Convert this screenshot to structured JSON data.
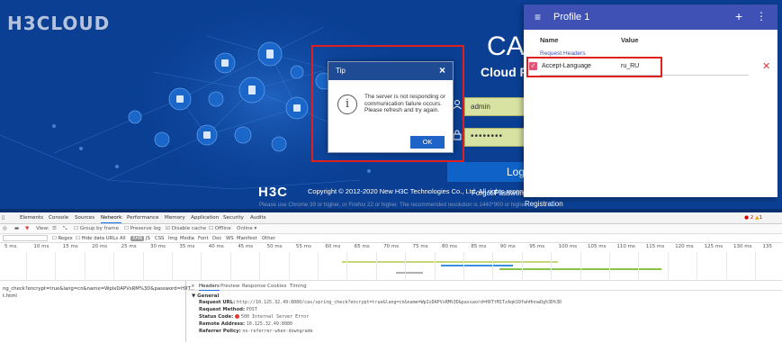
{
  "brand": {
    "logo": "H3CLOUD",
    "ca_mark": "CA",
    "product_title": "Cloud P"
  },
  "login": {
    "username_value": "admin",
    "password_value": "••••••••",
    "login_button": "Log",
    "forgot_password": "Forgot Password",
    "h3c_mark": "H3C",
    "copyright": "Copyright © 2012-2020 New H3C Technologies Co., Ltd. All rights reserved.",
    "browser_hint": "Please use Chrome 39 or higher, or Firefox 22 or higher. The recommended resolution is 1440*900 or higher.",
    "registration": "Registration"
  },
  "tip_dialog": {
    "title": "Tip",
    "close_glyph": "×",
    "info_glyph": "i",
    "message": "The server is not responding or communication failure occurs. Please refresh and try again.",
    "ok_label": "OK"
  },
  "profile_panel": {
    "menu_glyph": "≡",
    "title": "Profile 1",
    "add_glyph": "+",
    "more_glyph": "⋮",
    "col_name": "Name",
    "col_value": "Value",
    "section": "Request Headers",
    "check_glyph": "✓",
    "header_name": "Accept-Language",
    "header_value": "ru_RU",
    "delete_glyph": "✕",
    "accent_color": "#3f51b5"
  },
  "devtools": {
    "tabs": [
      "Elements",
      "Console",
      "Sources",
      "Network",
      "Performance",
      "Memory",
      "Application",
      "Security",
      "Audits"
    ],
    "active_tab": "Network",
    "errors": "2",
    "warnings": "1",
    "toolbar": {
      "view": "View:",
      "group_by_frame": "Group by frame",
      "preserve_log": "Preserve log",
      "disable_cache": "Disable cache",
      "offline": "Offline",
      "online": "Online"
    },
    "filter": {
      "regex": "Regex",
      "hide_data_urls": "Hide data URLs",
      "types": [
        "All",
        "XHR",
        "JS",
        "CSS",
        "Img",
        "Media",
        "Font",
        "Doc",
        "WS",
        "Manifest",
        "Other"
      ],
      "selected_type": "XHR"
    },
    "ticks": [
      "5 ms",
      "10 ms",
      "15 ms",
      "20 ms",
      "25 ms",
      "30 ms",
      "35 ms",
      "40 ms",
      "45 ms",
      "50 ms",
      "55 ms",
      "60 ms",
      "65 ms",
      "70 ms",
      "75 ms",
      "80 ms",
      "85 ms",
      "90 ms",
      "95 ms",
      "100 ms",
      "105 ms",
      "110 ms",
      "115 ms",
      "120 ms",
      "125 ms",
      "130 ms",
      "135"
    ],
    "requests": [
      "ng_check?encrypt=true&lang=cn&name=WpIxDAPVsRM%3D&password=HXT...",
      "t.html"
    ],
    "detail_tabs": [
      "×",
      "Headers",
      "Preview",
      "Response",
      "Cookies",
      "Timing"
    ],
    "active_detail_tab": "Headers",
    "general_label": "▼ General",
    "general": [
      {
        "key": "Request URL:",
        "value": "http://10.125.32.49:8080/cas/spring_check?encrypt=true&lang=cn&name=WpIxDAPVsRM%3D&password=HXTtM1TzAqkS9fwhHnnwDg%3D%3D"
      },
      {
        "key": "Request Method:",
        "value": "POST"
      },
      {
        "key": "Status Code:",
        "value": "500 Internal Server Error"
      },
      {
        "key": "Remote Address:",
        "value": "10.125.32.49:8080"
      },
      {
        "key": "Referrer Policy:",
        "value": "no-referrer-when-downgrade"
      }
    ]
  }
}
